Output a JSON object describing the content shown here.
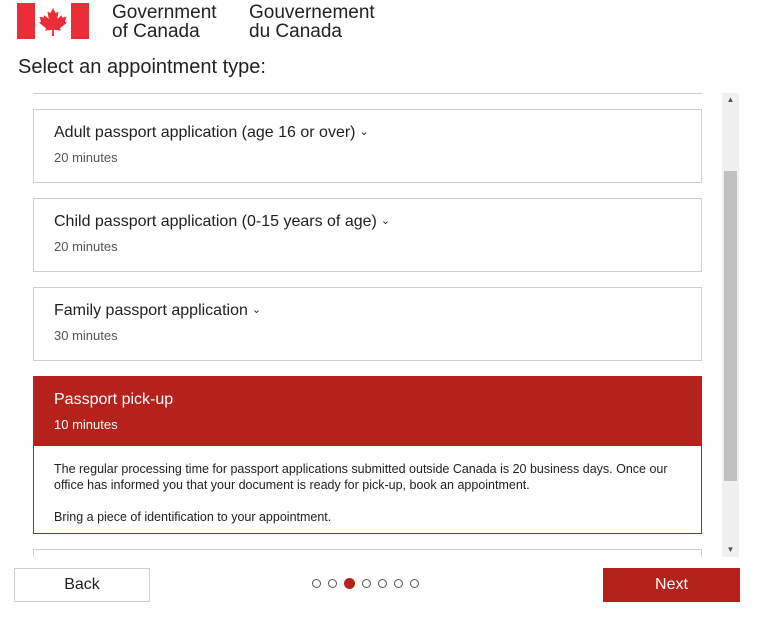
{
  "header": {
    "brand_en_line1": "Government",
    "brand_en_line2": "of Canada",
    "brand_fr_line1": "Gouvernement",
    "brand_fr_line2": "du Canada",
    "flag_icon": "canada-flag-icon",
    "flag_color": "#eb2d37"
  },
  "page_title": "Select an appointment type:",
  "appointment_types": [
    {
      "title": "Adult passport application (age 16 or over)",
      "duration": "20 minutes",
      "expandable": true
    },
    {
      "title": "Child passport application (0-15 years of age)",
      "duration": "20 minutes",
      "expandable": true
    },
    {
      "title": "Family passport application",
      "duration": "30 minutes",
      "expandable": true
    },
    {
      "title": "Passport pick-up",
      "duration": "10 minutes",
      "selected": true,
      "description_1": "The regular processing time for passport applications submitted outside Canada is 20 business days. Once our office has informed you that your document is ready for pick-up, book an appointment.",
      "description_2": "Bring a piece of identification to your appointment."
    }
  ],
  "footer": {
    "back_label": "Back",
    "next_label": "Next",
    "steps_total": 7,
    "current_step": 3
  },
  "colors": {
    "accent": "#b5211b",
    "border": "#cfcfcf"
  }
}
